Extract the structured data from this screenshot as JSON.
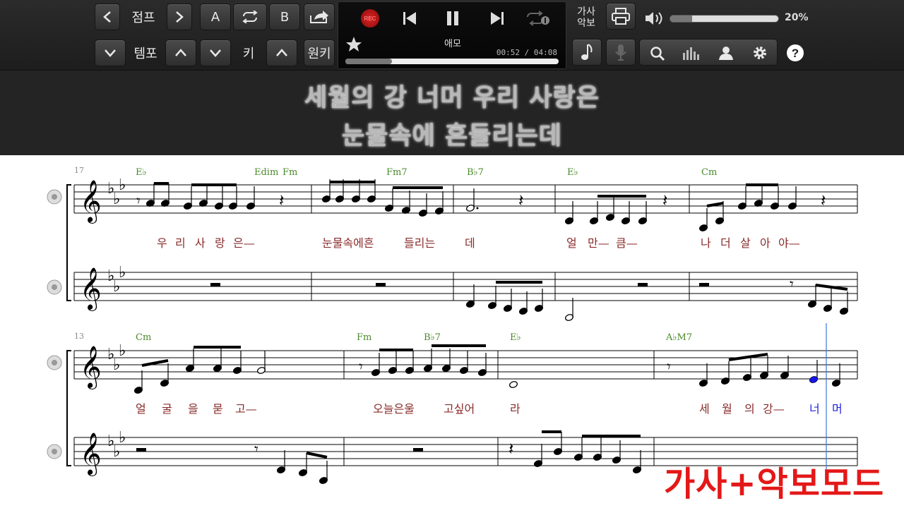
{
  "toolbar": {
    "jump_label": "점프",
    "tempo_label": "템포",
    "a_label": "A",
    "b_label": "B",
    "key_label": "키",
    "original_key_label": "원키",
    "lyrics_score_label_1": "가사",
    "lyrics_score_label_2": "악보",
    "volume_percent": "20%",
    "volume_level": 0.2
  },
  "player": {
    "rec_label": "REC",
    "song_title": "애모",
    "time": "00:52 / 04:08",
    "progress": 0.22
  },
  "lyrics_display": {
    "line1": "세월의 강 너머 우리 사랑은",
    "line2": "눈물속에 흔들리는데"
  },
  "score": {
    "system1": {
      "measure_number": "17",
      "chords": [
        "E♭",
        "Edim",
        "Fm",
        "Fm7",
        "B♭7",
        "E♭",
        "Cm"
      ],
      "lyrics": [
        "우",
        "리",
        "사",
        "랑",
        "은—",
        "눈물속에흔",
        "들리는",
        "데",
        "얼",
        "만—",
        "큼—",
        "나",
        "더",
        "살",
        "아",
        "야—"
      ]
    },
    "system2": {
      "measure_number": "13",
      "chords": [
        "Cm",
        "Fm",
        "B♭7",
        "E♭",
        "A♭M7"
      ],
      "lyrics": [
        "얼",
        "굴",
        "을",
        "묻",
        "고—",
        "오늘은울",
        "고싶어",
        "라",
        "세",
        "월",
        "의",
        "강—"
      ],
      "lyrics_highlight": [
        "너",
        "머"
      ]
    }
  },
  "mode_label": "가사+악보모드"
}
